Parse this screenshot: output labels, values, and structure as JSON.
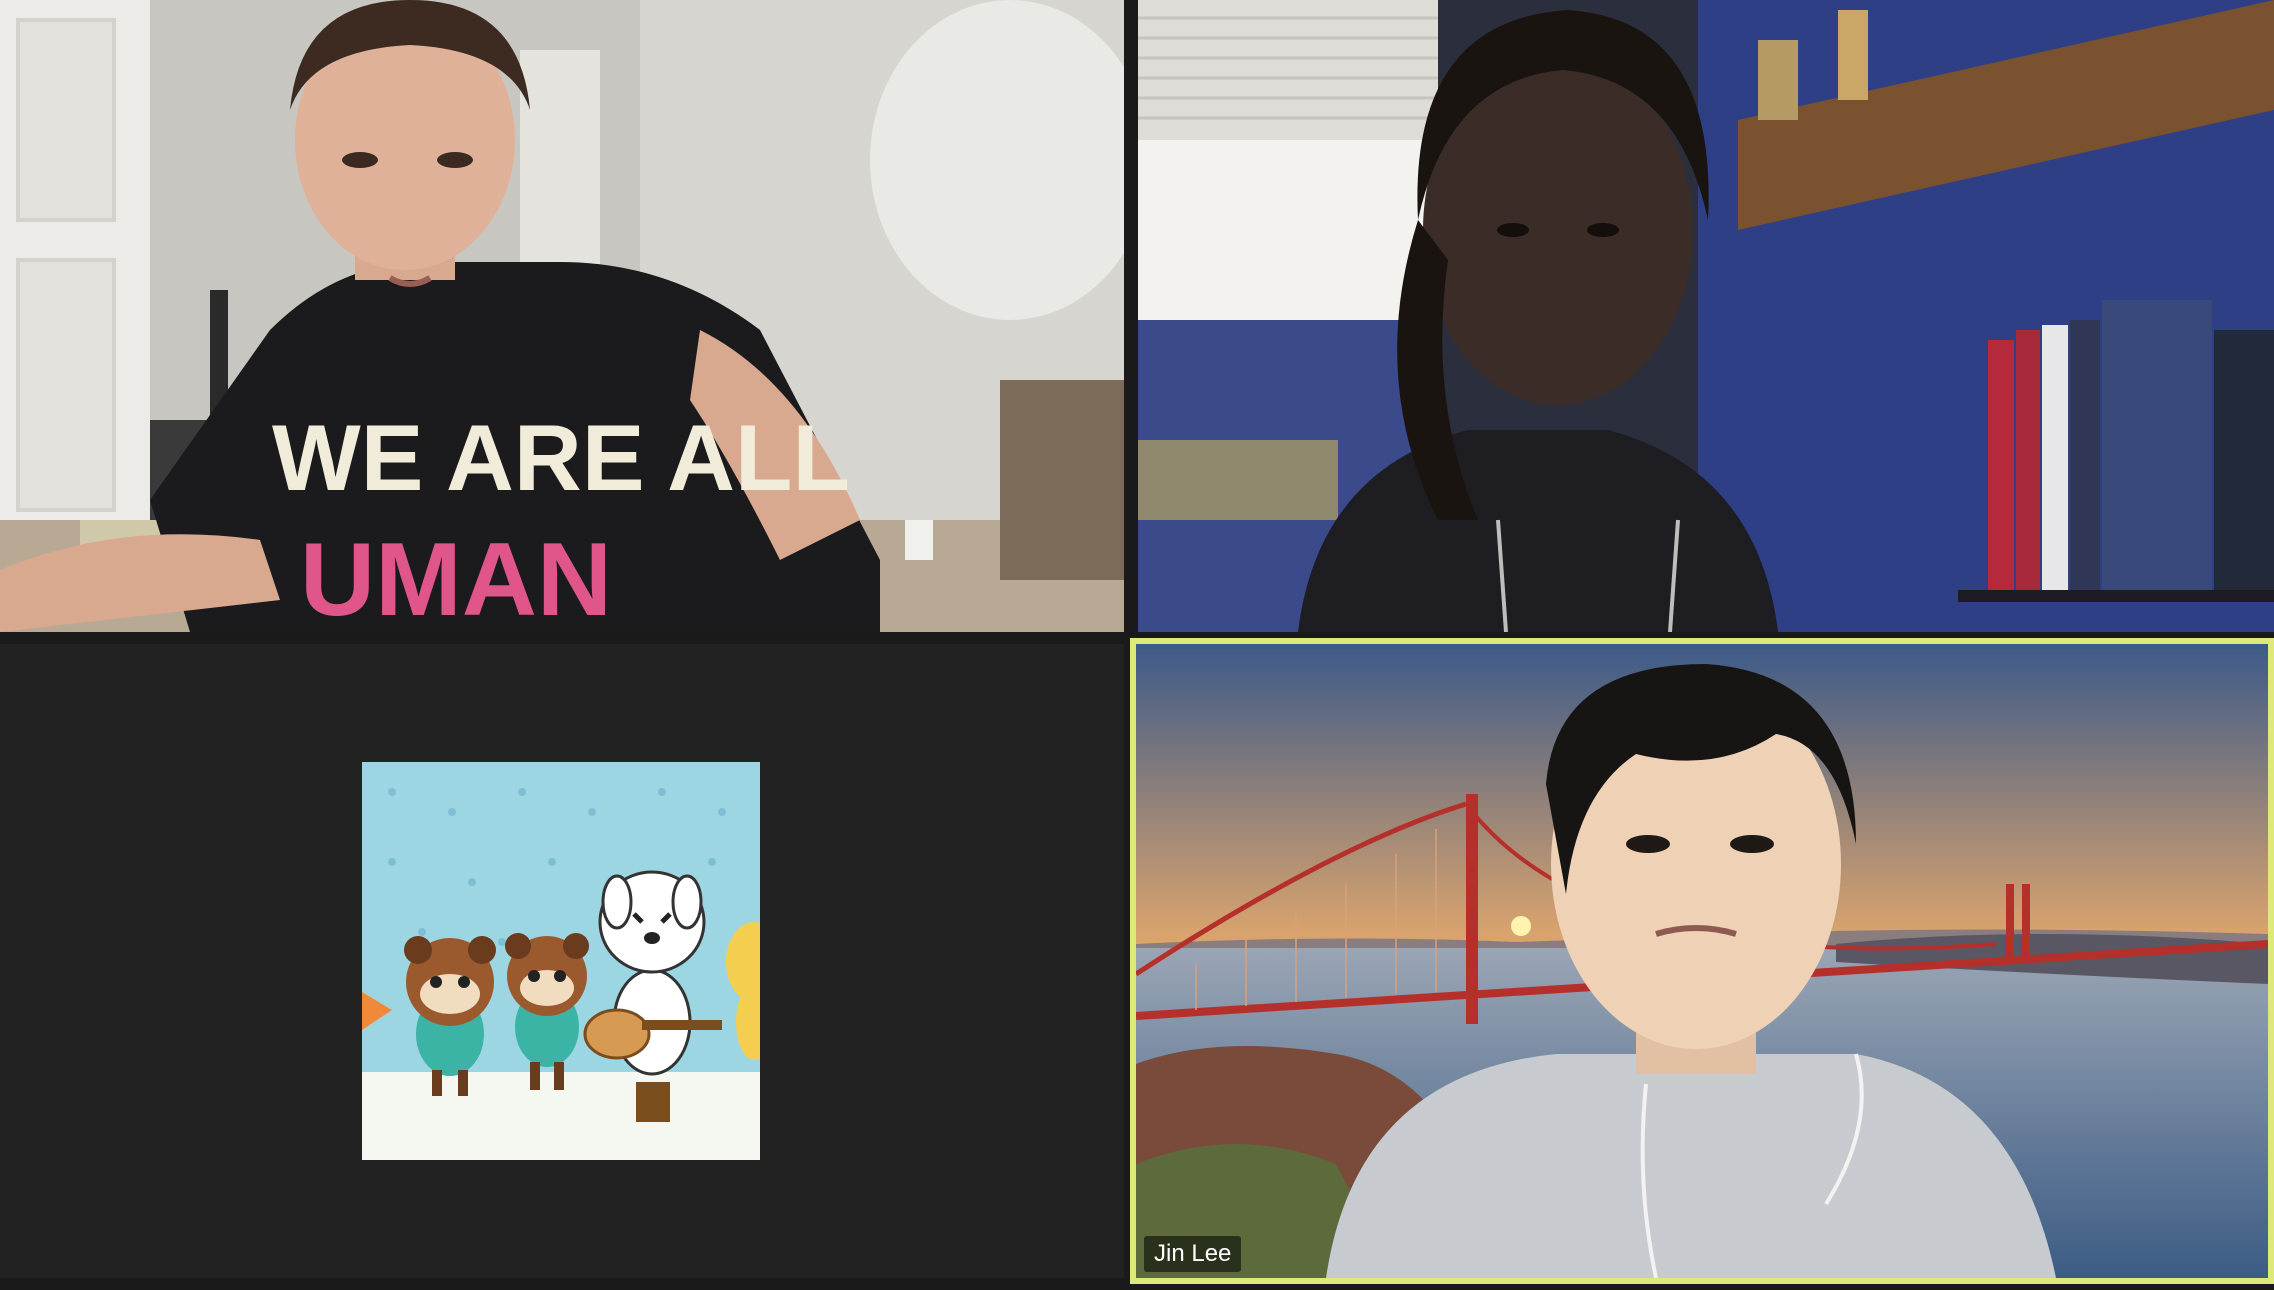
{
  "meeting": {
    "participants": [
      {
        "id": "p1",
        "name": "",
        "shirt_text_line1": "WE ARE ALL",
        "shirt_text_line2": "UMAN"
      },
      {
        "id": "p2",
        "name": ""
      },
      {
        "id": "p3",
        "name": "",
        "video_off": true
      },
      {
        "id": "p4",
        "name": "Jin Lee",
        "active_speaker": true
      }
    ],
    "colors": {
      "active_speaker_border": "#dfe87a",
      "gallery_background": "#1a1a1a"
    }
  }
}
